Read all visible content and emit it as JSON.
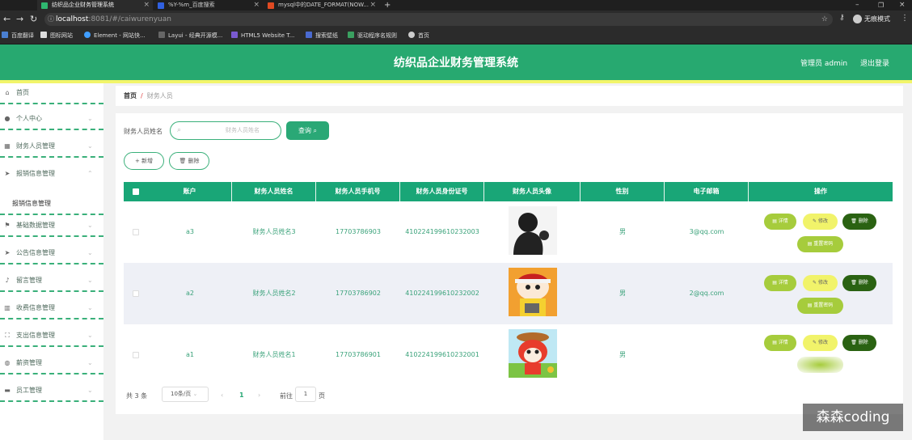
{
  "browser": {
    "tabs": [
      {
        "title": "纺织品企业财务管理系统",
        "active": true
      },
      {
        "title": "%Y-%m_百度搜索",
        "active": false
      },
      {
        "title": "mysql中的DATE_FORMAT(NOW...",
        "active": false
      }
    ],
    "url_host": "localhost",
    "url_path": ":8081/#/caiwurenyuan",
    "incognito_label": "无痕模式",
    "bookmarks": [
      "百度翻译",
      "图标网站",
      "Element - 网站快...",
      "Layui - 经典开源模...",
      "HTML5 Website T...",
      "搜索壁纸",
      "驱动程序名规则",
      "首页"
    ]
  },
  "app": {
    "title": "纺织品企业财务管理系统",
    "user_label": "管理员 admin",
    "logout_label": "退出登录"
  },
  "sidebar": {
    "items": [
      {
        "label": "首页",
        "icon": "home-icon"
      },
      {
        "label": "个人中心",
        "icon": "user-icon"
      },
      {
        "label": "财务人员管理",
        "icon": "grid-icon"
      },
      {
        "label": "报销信息管理",
        "icon": "send-icon"
      },
      {
        "label": "基础数据管理",
        "icon": "flag-icon"
      },
      {
        "label": "公告信息管理",
        "icon": "send-icon"
      },
      {
        "label": "留言管理",
        "icon": "mic-icon"
      },
      {
        "label": "收费信息管理",
        "icon": "chart-icon"
      },
      {
        "label": "支出信息管理",
        "icon": "frame-icon"
      },
      {
        "label": "薪资管理",
        "icon": "globe-icon"
      },
      {
        "label": "员工管理",
        "icon": "monitor-icon"
      }
    ],
    "sub_item": "报销信息管理"
  },
  "breadcrumb": {
    "home": "首页",
    "separator": "/",
    "current": "财务人员"
  },
  "search": {
    "label": "财务人员姓名",
    "placeholder": "财务人员姓名",
    "button": "查询"
  },
  "actions": {
    "add": "新增",
    "delete": "删除"
  },
  "table": {
    "columns": [
      "账户",
      "财务人员姓名",
      "财务人员手机号",
      "财务人员身份证号",
      "财务人员头像",
      "性别",
      "电子邮箱",
      "操作"
    ],
    "rows": [
      {
        "account": "a3",
        "name": "财务人员姓名3",
        "phone": "17703786903",
        "id_card": "410224199610232003",
        "gender": "男",
        "email": "3@qq.com",
        "avatar": "dark-silhouette"
      },
      {
        "account": "a2",
        "name": "财务人员姓名2",
        "phone": "17703786902",
        "id_card": "410224199610232002",
        "gender": "男",
        "email": "2@qq.com",
        "avatar": "cartoon-boy"
      },
      {
        "account": "a1",
        "name": "财务人员姓名1",
        "phone": "17703786901",
        "id_card": "410224199610232001",
        "gender": "男",
        "email": "",
        "avatar": "cartoon-fox"
      }
    ],
    "ops": {
      "detail": "详情",
      "edit": "修改",
      "delete": "删除",
      "reset": "重置密码"
    }
  },
  "pagination": {
    "total": "共 3 条",
    "page_size": "10条/页",
    "current": "1",
    "goto_label": "前往",
    "goto_value": "1",
    "page_suffix": "页"
  },
  "watermark": "森森coding",
  "colors": {
    "primary": "#27a970",
    "accent_yellow": "#f2f56a",
    "detail_btn": "#a6cc3c",
    "delete_btn": "#2a6212"
  }
}
